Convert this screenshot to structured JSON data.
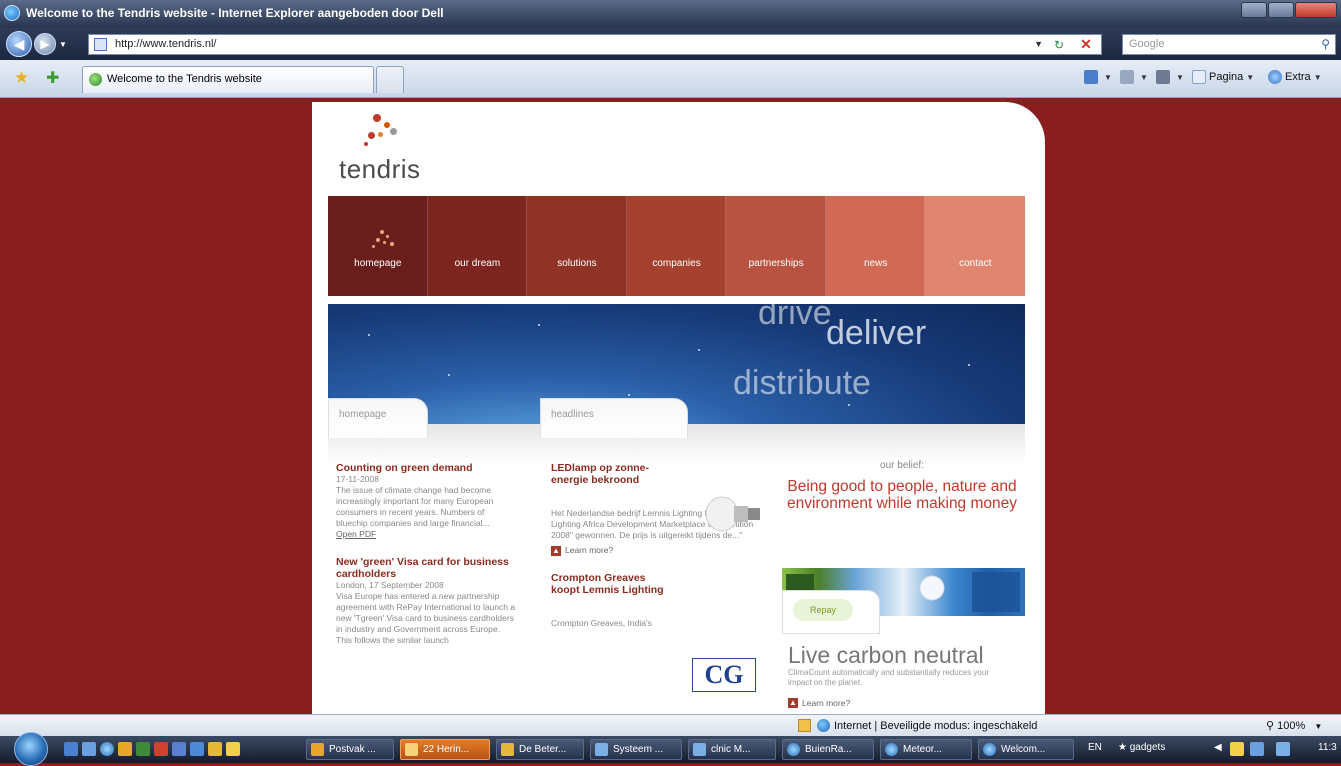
{
  "window": {
    "title": "Welcome to the Tendris website - Internet Explorer aangeboden door Dell"
  },
  "address_bar": {
    "url": "http://www.tendris.nl/",
    "search_placeholder": "Google"
  },
  "tab_bar": {
    "active_tab": "Welcome to the Tendris website",
    "pagina_label": "Pagina",
    "extra_label": "Extra"
  },
  "site": {
    "logo": "tendris",
    "nav": [
      {
        "label": "homepage",
        "color": "#6b1f1c"
      },
      {
        "label": "our dream",
        "color": "#7d2620"
      },
      {
        "label": "solutions",
        "color": "#8f3327"
      },
      {
        "label": "companies",
        "color": "#a6412f"
      },
      {
        "label": "partnerships",
        "color": "#b85341"
      },
      {
        "label": "news",
        "color": "#d06a55"
      },
      {
        "label": "contact",
        "color": "#e08670"
      }
    ],
    "banner_words": {
      "drive": "drive",
      "deliver": "deliver",
      "distribute": "distribute"
    },
    "tabs": {
      "homepage": "homepage",
      "headlines": "headlines"
    },
    "left_col": {
      "item1": {
        "title": "Counting on green demand",
        "date": "17-11-2008",
        "body": "The issue of climate change had become increasingly important for many European consumers in recent years. Numbers of bluechip companies and large financial...",
        "link": "Open PDF"
      },
      "item2": {
        "title": "New 'green' Visa card for business cardholders",
        "date": "London, 17 September 2008",
        "body": "Visa Europe has entered a new partnership agreement with RePay International to launch a new 'Tgreen' Visa card to business cardholders in industry and Government across Europe. This follows the similar launch"
      }
    },
    "mid_col": {
      "item1": {
        "title": "LEDlamp op zonne-energie bekroond",
        "body": "Het Nederlandse bedrijf Lemnis Lighting heeft de \"The Lighting Africa Development Marketplace Competition 2008\" gewonnen. De prijs is uitgereikt tijdens de...\"",
        "learn": "Learn more?"
      },
      "item2": {
        "title": "Crompton Greaves koopt Lemnis Lighting",
        "body": "Crompton Greaves, India's",
        "logo": "CG"
      }
    },
    "right_col": {
      "belief_label": "our belief:",
      "belief": "Being good to people, nature and environment while making money",
      "repay_logo": "Repay",
      "lcn_title": "Live carbon neutral",
      "lcn_sub": "ClimaCount automatically and substantially reduces your impact on the planet.",
      "lcn_learn": "Learn more?"
    }
  },
  "status_bar": {
    "zone": "Internet | Beveiligde modus: ingeschakeld",
    "zoom": "100%"
  },
  "taskbar": {
    "buttons": [
      "Postvak ...",
      "22 Herin...",
      "De Beter...",
      "Systeem ...",
      "clnic M...",
      "BuienRa...",
      "Meteor...",
      "Welcom..."
    ],
    "lang": "EN",
    "gadgets": "gadgets",
    "clock": "11:3"
  }
}
